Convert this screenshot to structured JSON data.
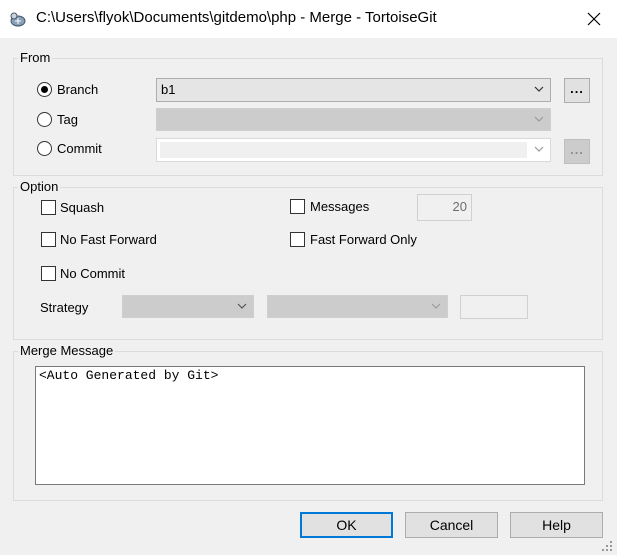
{
  "window": {
    "title": "C:\\Users\\flyok\\Documents\\gitdemo\\php - Merge - TortoiseGit"
  },
  "from": {
    "group_label": "From",
    "branch_label": "Branch",
    "tag_label": "Tag",
    "commit_label": "Commit",
    "branch_value": "b1",
    "selected": "Branch",
    "browse_label": "...",
    "commit_browse_label": "..."
  },
  "option": {
    "group_label": "Option",
    "squash_label": "Squash",
    "no_fast_forward_label": "No Fast Forward",
    "no_commit_label": "No Commit",
    "messages_label": "Messages",
    "messages_value": "20",
    "fast_forward_only_label": "Fast Forward Only",
    "strategy_label": "Strategy"
  },
  "merge_message": {
    "group_label": "Merge Message",
    "text": "<Auto Generated by Git>"
  },
  "buttons": {
    "ok": "OK",
    "cancel": "Cancel",
    "help": "Help"
  },
  "icons": {
    "app": "tortoisegit-icon",
    "close": "close-icon",
    "dropdown": "chevron-down-icon",
    "resize": "resize-grip-icon"
  },
  "colors": {
    "focus": "#0078d7",
    "window_bg": "#f0f0f0"
  }
}
